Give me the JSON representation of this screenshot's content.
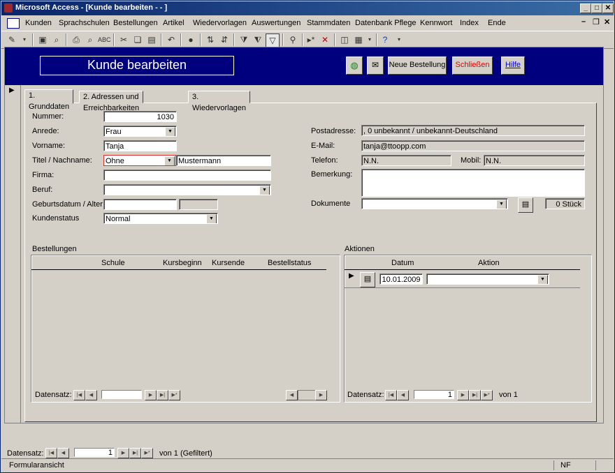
{
  "window": {
    "title": "Microsoft Access - [Kunde bearbeiten - - ]"
  },
  "menu": [
    "Kunden",
    "Sprachschulen",
    "Bestellungen",
    "Artikel",
    "Wiedervorlagen",
    "Auswertungen",
    "Stammdaten",
    "Datenbank Pflege",
    "Kennwort",
    "Index",
    "Ende"
  ],
  "header": {
    "title": "Kunde bearbeiten",
    "new_order": "Neue Bestellung",
    "close": "Schließen",
    "help": "Hilfe"
  },
  "tabs": [
    "1. Grunddaten",
    "2. Adressen und Erreichbarkeiten",
    "3. Wiedervorlagen"
  ],
  "fields": {
    "nummer_label": "Nummer:",
    "nummer": "1030",
    "anrede_label": "Anrede:",
    "anrede": "Frau",
    "vorname_label": "Vorname:",
    "vorname": "Tanja",
    "titel_label": "Titel / Nachname:",
    "titel": "Ohne",
    "nachname": "Mustermann",
    "firma_label": "Firma:",
    "firma": "",
    "beruf_label": "Beruf:",
    "beruf": "",
    "geburt_label": "Geburtsdatum / Alter:",
    "geburt": "",
    "alter": "",
    "status_label": "Kundenstatus",
    "status": "Normal",
    "post_label": "Postadresse:",
    "post": ", 0 unbekannt / unbekannt-Deutschland",
    "email_label": "E-Mail:",
    "email": "tanja@ttoopp.com",
    "tel_label": "Telefon:",
    "tel": "N.N.",
    "mobil_label": "Mobil:",
    "mobil": "N.N.",
    "bem_label": "Bemerkung:",
    "bem": "",
    "dok_label": "Dokumente",
    "dok": "",
    "dok_count": "0 Stück"
  },
  "orders": {
    "title": "Bestellungen",
    "columns": [
      "Schule",
      "Kursbeginn",
      "Kursende",
      "Bestellstatus"
    ],
    "nav_label": "Datensatz:",
    "nav_value": ""
  },
  "actions": {
    "title": "Aktionen",
    "columns": [
      "Datum",
      "Aktion"
    ],
    "row_date": "10.01.2009",
    "row_action": "",
    "nav_label": "Datensatz:",
    "nav_value": "1",
    "nav_of": "von 1"
  },
  "main_nav": {
    "label": "Datensatz:",
    "value": "1",
    "of": "von 1 (Gefiltert)"
  },
  "status": {
    "left": "Formularansicht",
    "right": "NF"
  }
}
